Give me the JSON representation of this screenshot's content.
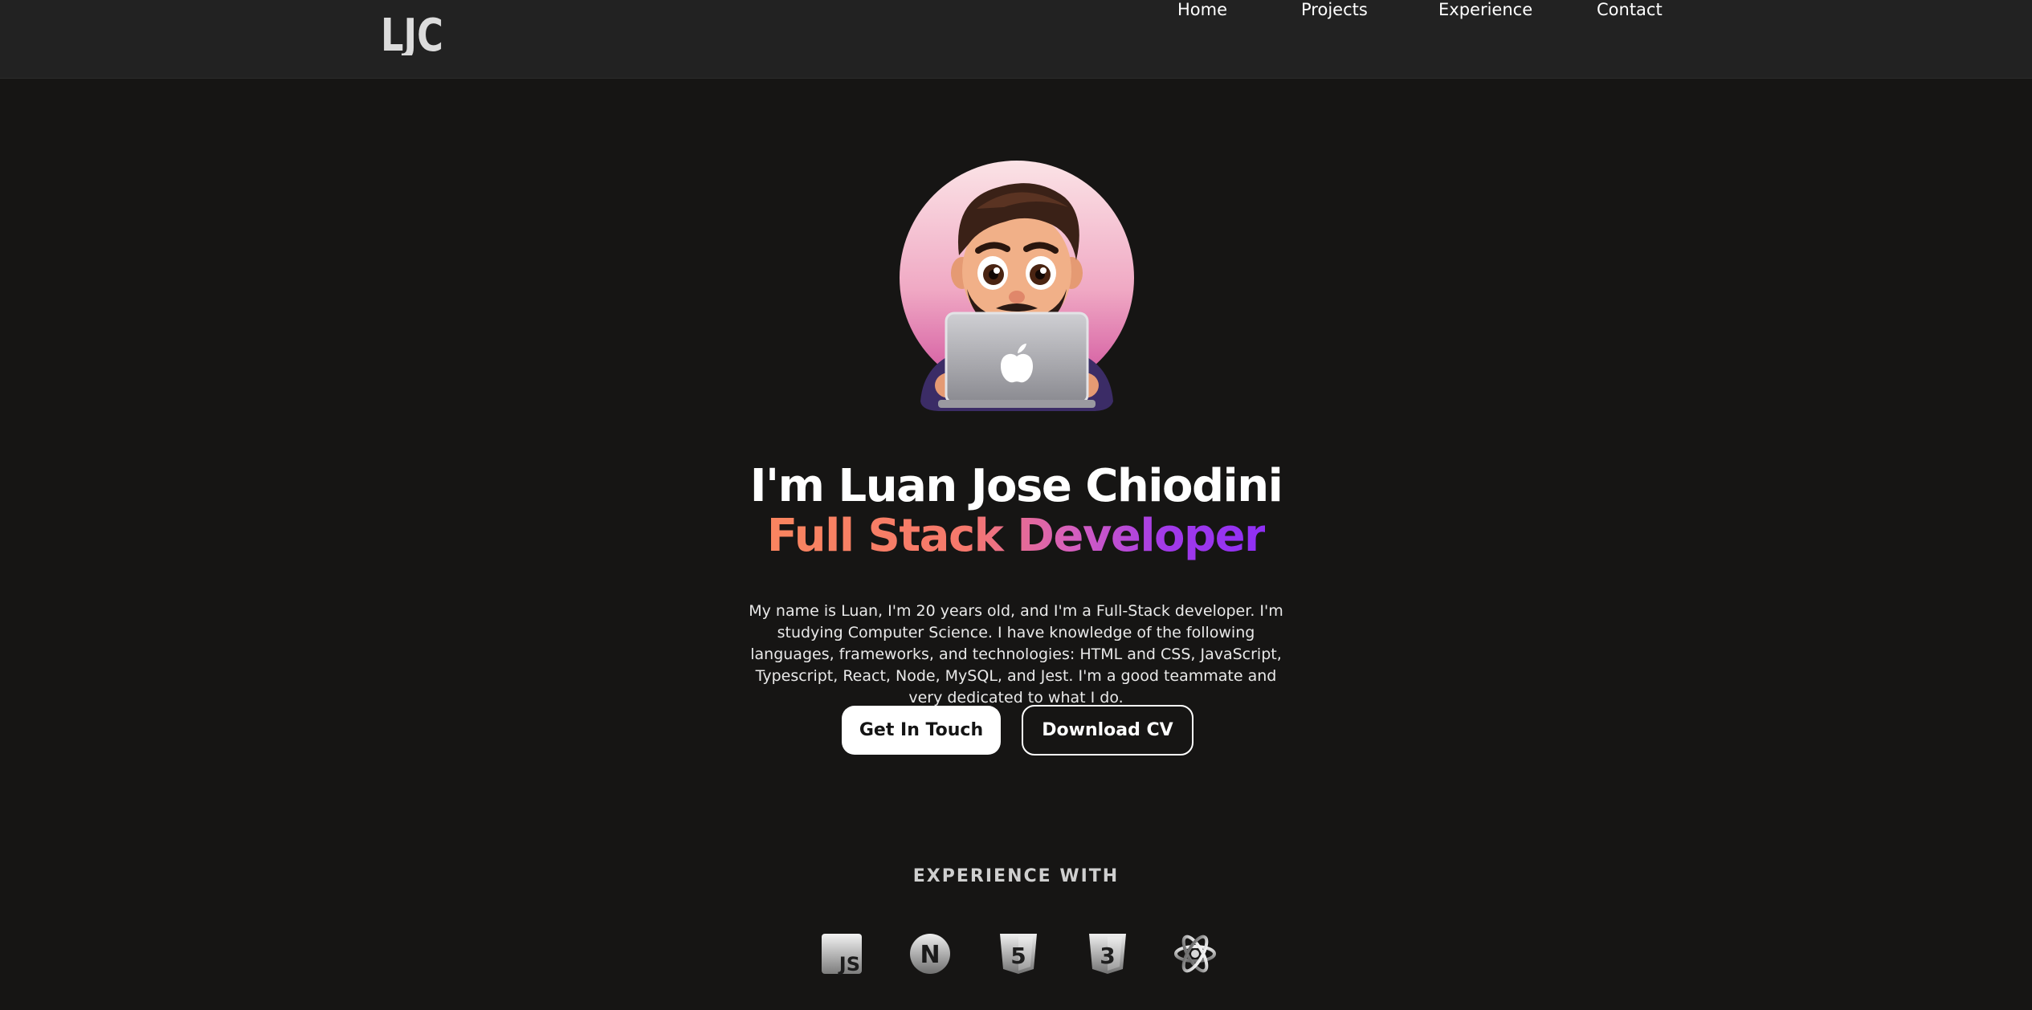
{
  "nav": {
    "logo_text": "LJC",
    "links": [
      "Home",
      "Projects",
      "Experience",
      "Contact"
    ]
  },
  "hero": {
    "avatar_icon": "developer-avatar-with-laptop",
    "title": "I'm Luan Jose Chiodini",
    "subtitle": "Full Stack Developer",
    "bio": "My name is Luan, I'm 20 years old, and I'm a Full-Stack developer. I'm studying Computer Science. I have knowledge of the following languages, frameworks, and technologies: HTML and CSS, JavaScript, Typescript, React, Node, MySQL, and Jest. I'm a good teammate and very dedicated to what I do.",
    "primary_button": "Get In Touch",
    "secondary_button": "Download CV"
  },
  "experience": {
    "title": "EXPERIENCE WITH",
    "technologies": [
      {
        "icon": "javascript-icon",
        "label": "JS"
      },
      {
        "icon": "nextjs-icon",
        "label": "N"
      },
      {
        "icon": "html5-icon",
        "label": "5"
      },
      {
        "icon": "css3-icon",
        "label": "3"
      },
      {
        "icon": "react-icon",
        "label": ""
      }
    ]
  },
  "colors": {
    "background": "#161514",
    "nav_background": "#222222",
    "gradient_start": "#f9855f",
    "gradient_end": "#8f2ff5"
  }
}
